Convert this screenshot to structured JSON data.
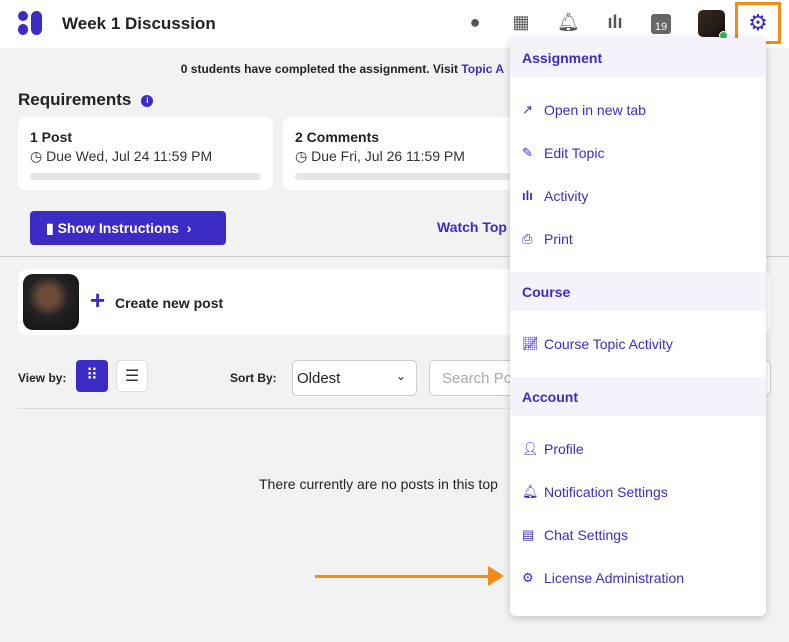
{
  "header": {
    "title": "Week 1 Discussion",
    "calendar_day": "19"
  },
  "notice": {
    "text": "0 students have completed the assignment. Visit ",
    "link": "Topic A"
  },
  "requirements": {
    "title": "Requirements",
    "info": "i",
    "cards": [
      {
        "name": "1 Post",
        "due": "Due Wed, Jul 24 11:59 PM"
      },
      {
        "name": "2 Comments",
        "due": "Due Fri, Jul 26 11:59 PM"
      }
    ]
  },
  "actions": {
    "show_instructions": "Show Instructions",
    "watch": "Watch Top"
  },
  "post": {
    "create": "Create new post"
  },
  "toolbar": {
    "view_by": "View by:",
    "sort_by": "Sort By:",
    "sort_value": "Oldest",
    "search_placeholder": "Search Po"
  },
  "empty": "There currently are no posts in this top",
  "menu": {
    "assignment": {
      "header": "Assignment",
      "items": [
        "Open in new tab",
        "Edit Topic",
        "Activity",
        "Print"
      ]
    },
    "course": {
      "header": "Course",
      "items": [
        "Course Topic Activity"
      ]
    },
    "account": {
      "header": "Account",
      "items": [
        "Profile",
        "Notification Settings",
        "Chat Settings",
        "License Administration"
      ]
    }
  },
  "colors": {
    "accent": "#3d2bc6",
    "highlight": "#f28c12"
  }
}
